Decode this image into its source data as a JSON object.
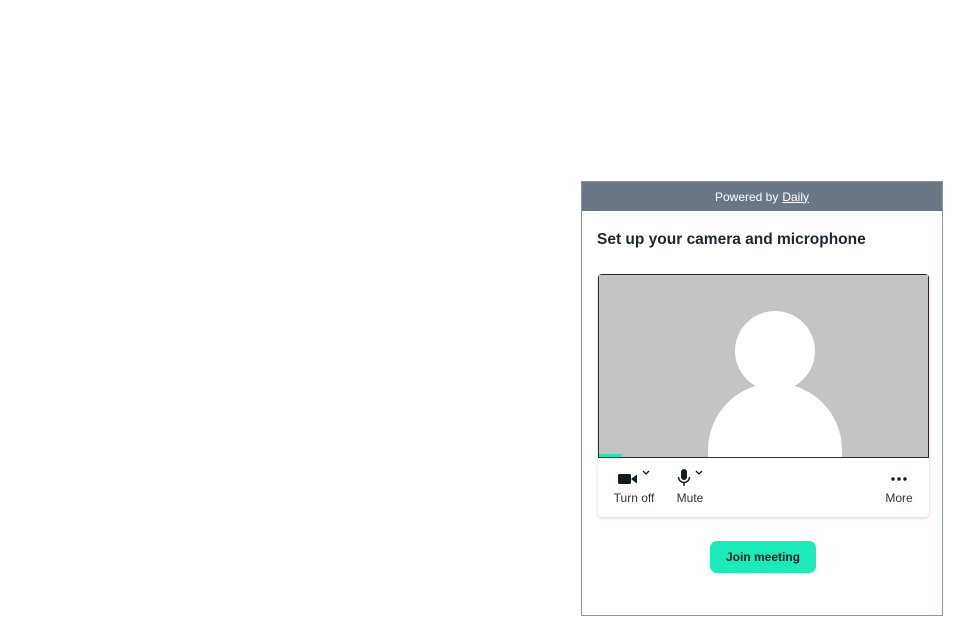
{
  "banner": {
    "prefix": "Powered by",
    "link": "Daily"
  },
  "setup": {
    "title": "Set up your camera and microphone"
  },
  "tray": {
    "camera_label": "Turn off",
    "mute_label": "Mute",
    "more_label": "More"
  },
  "join": {
    "label": "Join meeting"
  },
  "icons": {
    "camera": "video-camera-icon",
    "microphone": "microphone-icon",
    "more": "more-dots-icon",
    "chevron": "chevron-down-icon"
  },
  "colors": {
    "banner_bg": "#6b7785",
    "accent": "#1bebb9",
    "video_placeholder": "#c4c4c4"
  },
  "audio_level": 0.07
}
